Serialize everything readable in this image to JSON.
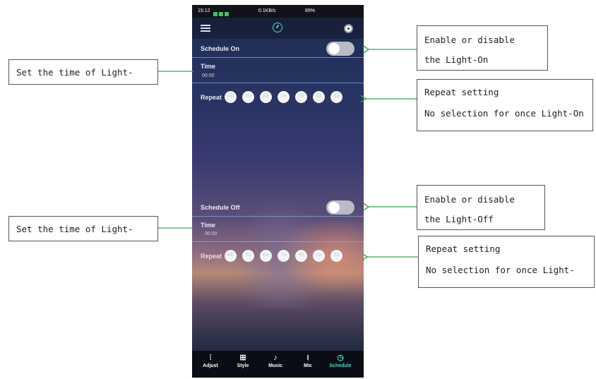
{
  "phone": {
    "status": {
      "time": "15:12",
      "network": "0.1KB/s",
      "battery": "89%"
    },
    "schedule_on": {
      "label": "Schedule On",
      "time_label": "Time",
      "time_value": "00:00",
      "repeat_label": "Repeat",
      "days": [
        "MO",
        "TU",
        "WE",
        "TH",
        "FR",
        "SA",
        "SU"
      ],
      "enabled": false
    },
    "schedule_off": {
      "label": "Schedule Off",
      "time_label": "Time",
      "time_value": "00:00",
      "repeat_label": "Repeat",
      "days": [
        "MO",
        "TU",
        "WE",
        "TH",
        "FR",
        "SA",
        "SU"
      ],
      "enabled": false
    },
    "tabs": [
      {
        "label": "Adjust",
        "icon": "sliders-icon"
      },
      {
        "label": "Style",
        "icon": "grid-icon"
      },
      {
        "label": "Music",
        "icon": "music-icon"
      },
      {
        "label": "Mic",
        "icon": "mic-icon"
      },
      {
        "label": "Schedule",
        "icon": "timer-icon",
        "active": true
      }
    ],
    "accent_color": "#46d3c7"
  },
  "annotations": {
    "left_on": "Set the time of Light-",
    "left_off": "Set the time of Light-",
    "right_on_enable": [
      "Enable or disable",
      "the Light-On"
    ],
    "right_on_repeat": [
      "Repeat setting",
      "No selection for once Light-On"
    ],
    "right_off_enable": [
      "Enable or disable",
      "the Light-Off"
    ],
    "right_off_repeat": [
      "Repeat setting",
      "No selection for once Light-"
    ]
  }
}
